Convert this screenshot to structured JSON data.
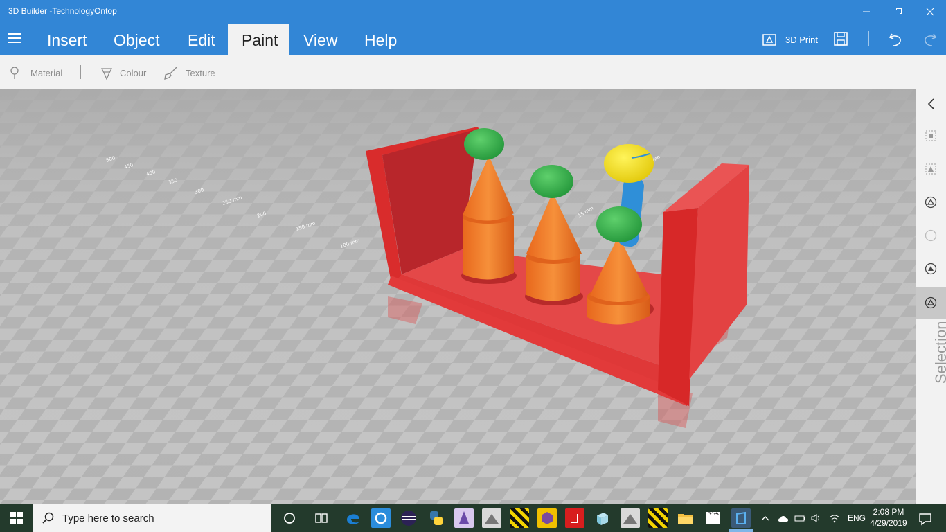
{
  "window": {
    "title": "3D Builder -TechnologyOntop"
  },
  "menu": {
    "tabs": [
      {
        "label": "Insert"
      },
      {
        "label": "Object"
      },
      {
        "label": "Edit"
      },
      {
        "label": "Paint",
        "active": true
      },
      {
        "label": "View"
      },
      {
        "label": "Help"
      }
    ],
    "print_label": "3D Print"
  },
  "paint_toolbar": {
    "material_label": "Material",
    "colour_label": "Colour",
    "texture_label": "Texture"
  },
  "viewport": {
    "grid_labels": [
      "100 mm",
      "150 mm",
      "200",
      "250 mm",
      "300",
      "350",
      "400",
      "450",
      "500",
      "15 mm",
      "10 mm"
    ]
  },
  "right_panel": {
    "selection_label": "Selection",
    "icons": [
      "chevron-left-icon",
      "select-object-icon",
      "select-face-icon",
      "select-edge-icon",
      "select-vertex-icon",
      "select-group-icon",
      "select-triangle-icon"
    ]
  },
  "taskbar": {
    "search_placeholder": "Type here to search",
    "language": "ENG",
    "time": "2:08 PM",
    "date": "4/29/2019"
  },
  "colors": {
    "accent": "#3286d6",
    "red": "#e33a3a",
    "orange": "#f07a2a",
    "green": "#3bb84c",
    "yellow": "#f2e01f",
    "blue": "#2f8fd8"
  }
}
